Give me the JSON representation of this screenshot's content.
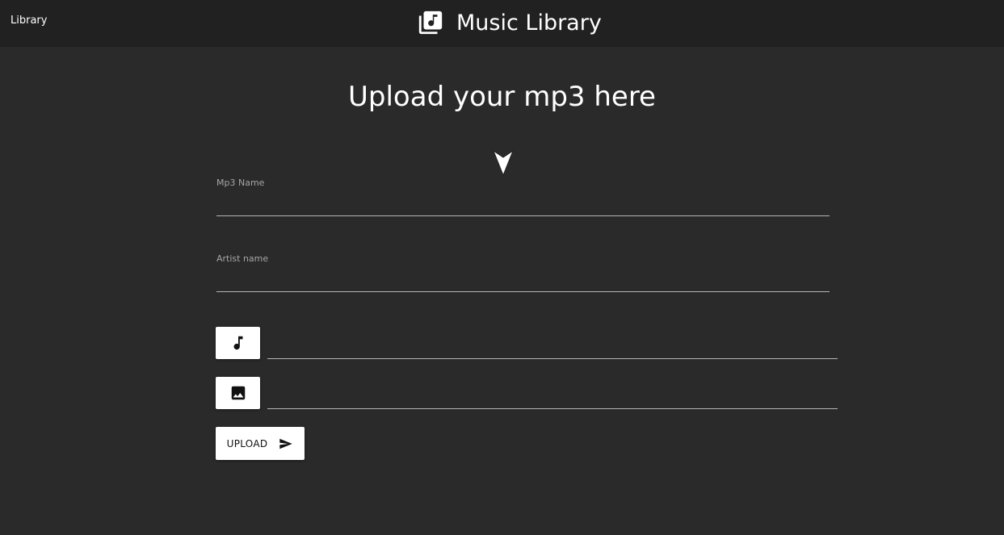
{
  "nav": {
    "link_label": "Library",
    "brand_icon": "library-music-icon",
    "title": "Music Library"
  },
  "page": {
    "heading": "Upload your mp3 here"
  },
  "form": {
    "mp3_name": {
      "label": "Mp3 Name",
      "value": ""
    },
    "artist_name": {
      "label": "Artist name",
      "value": ""
    },
    "audio_file": {
      "icon": "music-note-icon",
      "value": ""
    },
    "cover_file": {
      "icon": "image-icon",
      "value": ""
    },
    "upload": {
      "label": "UPLOAD",
      "icon": "send-icon"
    }
  },
  "colors": {
    "background": "#2a2a2a",
    "topbar": "#212121",
    "text": "#ffffff",
    "label": "#a6a6a6",
    "underline": "#b5b5b5",
    "button": "#ffffff"
  }
}
